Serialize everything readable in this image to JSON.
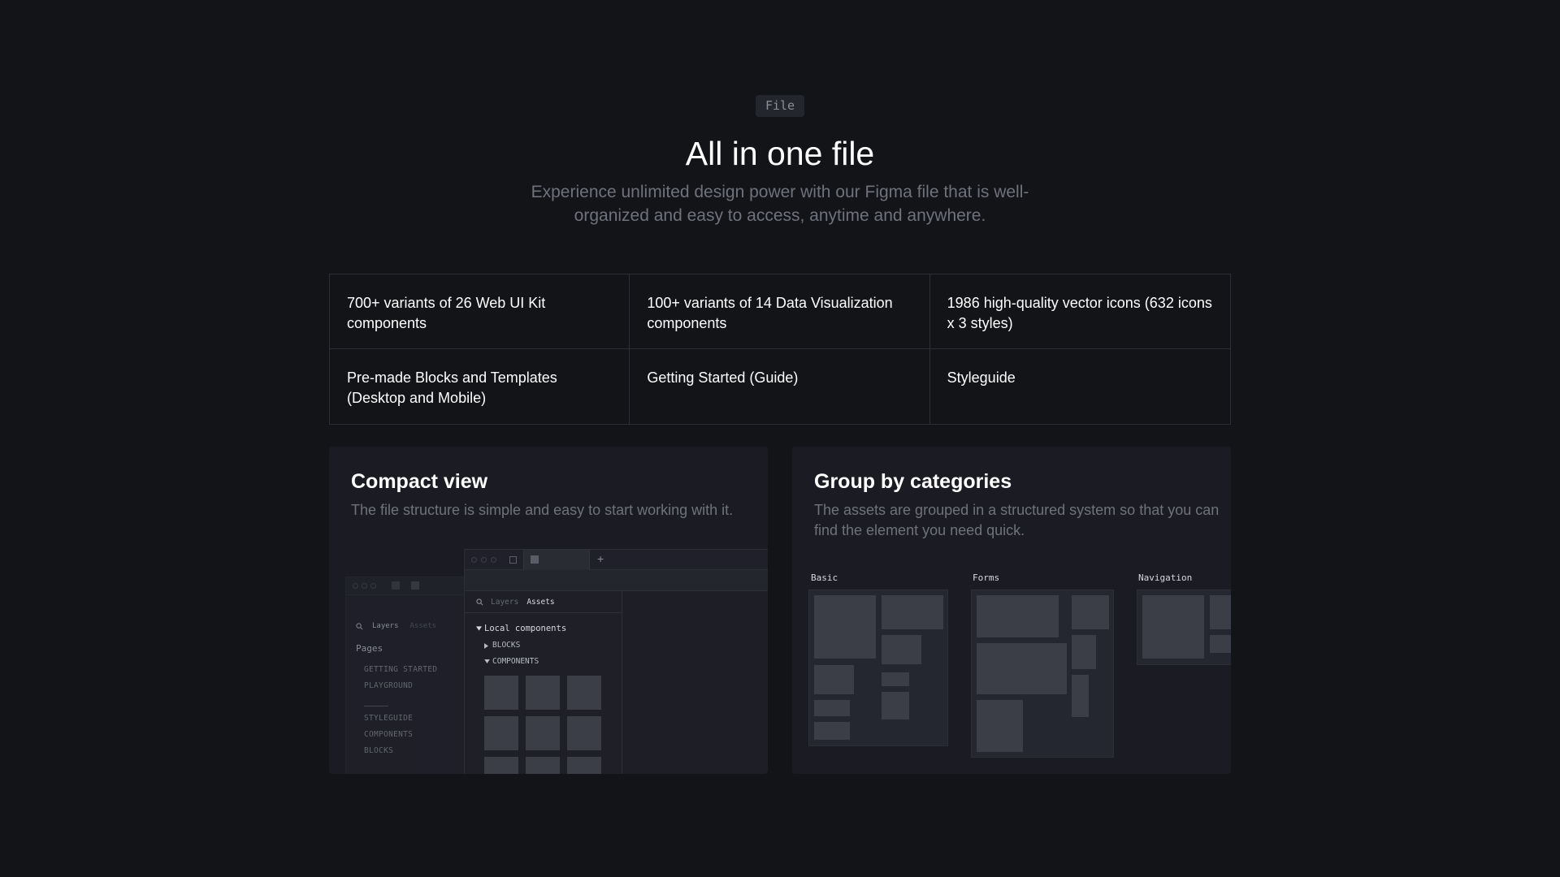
{
  "header": {
    "badge": "File",
    "title": "All in one file",
    "subtitle": "Experience unlimited design power with our Figma file that is well-organized and easy to access, anytime and anywhere."
  },
  "features": [
    "700+ variants of 26 Web UI Kit components",
    "100+ variants of 14 Data Visualization components",
    "1986 high-quality vector icons (632 icons x 3 styles)",
    "Pre-made Blocks and Templates (Desktop and Mobile)",
    "Getting Started (Guide)",
    "Styleguide"
  ],
  "compact": {
    "title": "Compact view",
    "description": "The file structure is simple and easy to start working with it.",
    "back_tabs": {
      "layers": "Layers",
      "assets": "Assets"
    },
    "pages_label": "Pages",
    "pages": [
      "GETTING STARTED",
      "PLAYGROUND",
      "STYLEGUIDE",
      "COMPONENTS",
      "BLOCKS"
    ],
    "front_tabs": {
      "layers": "Layers",
      "assets": "Assets"
    },
    "local_components": "Local components",
    "tree": [
      "BLOCKS",
      "COMPONENTS"
    ]
  },
  "categories": {
    "title": "Group by categories",
    "description": "The assets are grouped in a structured system so that you can find the element you need quick.",
    "labels": [
      "Basic",
      "Forms",
      "Navigation"
    ]
  },
  "colors": {
    "background": "#131418",
    "card": "#1b1c23",
    "muted_text": "#6f727c",
    "block": "#3b3d47"
  }
}
